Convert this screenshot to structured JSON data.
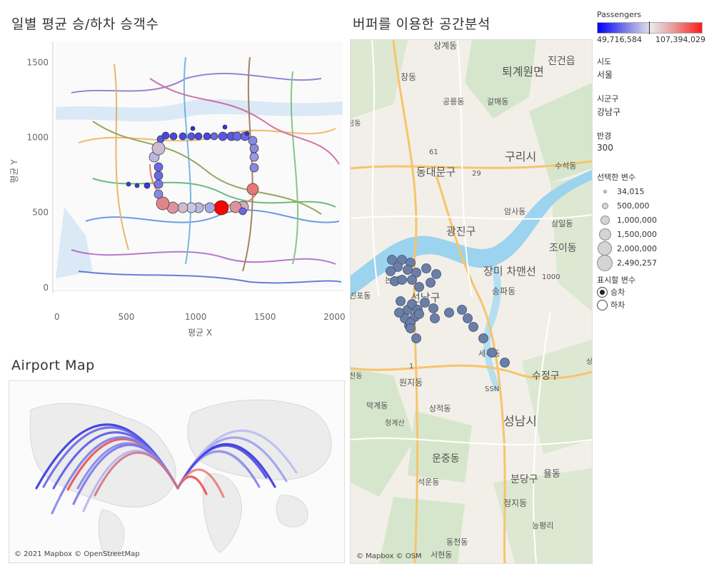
{
  "titles": {
    "subway": "일별 평균 승/하차 승객수",
    "buffer": "버퍼를 이용한 공간분석",
    "airport": "Airport Map"
  },
  "subway_chart": {
    "xlabel": "평균 X",
    "ylabel": "평균 Y",
    "x_ticks": [
      "0",
      "500",
      "1000",
      "1500",
      "2000"
    ],
    "y_ticks": [
      "0",
      "500",
      "1000",
      "1500"
    ],
    "xlim": [
      -30,
      2060
    ],
    "ylim": [
      -20,
      1640
    ]
  },
  "colors": {
    "low": "#0000ff",
    "mid": "#e8e8ea",
    "high": "#ff1a1a",
    "buffer_dot": "#6b7fa6"
  },
  "legend": {
    "passengers_title": "Passengers",
    "passengers_min": "49,716,584",
    "passengers_max": "107,394,029",
    "sido_label": "시도",
    "sido_value": "서울",
    "sigungu_label": "시군구",
    "sigungu_value": "강남구",
    "radius_label": "반경",
    "radius_value": "300",
    "selected_var_label": "선택한 변수",
    "sizes": [
      "34,015",
      "500,000",
      "1,000,000",
      "1,500,000",
      "2,000,000",
      "2,490,257"
    ],
    "display_label": "표시할 변수",
    "options": [
      "승차",
      "하차"
    ],
    "selected_option": "승차"
  },
  "map_labels": {
    "buffer": [
      "상계동",
      "진건읍",
      "창동",
      "퇴계원면",
      "공릉동",
      "갈매동",
      "금동",
      "61",
      "동대문구",
      "구리시",
      "수석동",
      "29",
      "암사동",
      "광진구",
      "삼일동",
      "조이동",
      "장미 차맨선",
      "1000",
      "논현동",
      "빈포동",
      "송파동",
      "선남구",
      "세곡동",
      "상",
      "천동",
      "1",
      "원지동",
      "수정구",
      "SSN",
      "막계동",
      "상적동",
      "청계산",
      "성남시",
      "운중동",
      "분당구",
      "율동",
      "석운동",
      "정지동",
      "능평리",
      "동천동",
      "서현동"
    ],
    "attribution": "© Mapbox © OSM"
  },
  "airport_map": {
    "attribution": "© 2021 Mapbox © OpenStreetMap"
  }
}
